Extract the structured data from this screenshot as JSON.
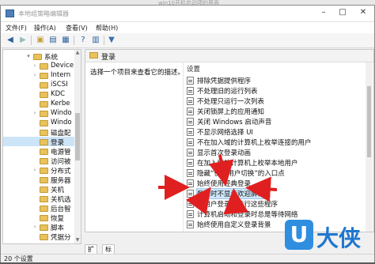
{
  "window": {
    "title": "本地组策略编辑器",
    "top_strip_text": "win10开机启动项的界面"
  },
  "menu": [
    "文件(F)",
    "操作(A)",
    "查看(V)",
    "帮助(H)"
  ],
  "toolbar": {
    "icons": [
      "back-icon",
      "forward-icon",
      "up-folder-icon",
      "show-hide-tree-icon",
      "export-icon",
      "help-icon",
      "properties-icon",
      "filter-icon"
    ]
  },
  "tree": {
    "items": [
      {
        "label": "系统",
        "expanded": true,
        "depth": 0,
        "selected": false
      },
      {
        "label": "Device",
        "expanded": false,
        "depth": 1,
        "selected": false
      },
      {
        "label": "Intern",
        "expanded": false,
        "depth": 1,
        "selected": false
      },
      {
        "label": "iSCSI",
        "expanded": false,
        "depth": 1,
        "selected": false
      },
      {
        "label": "KDC",
        "expanded": false,
        "depth": 1,
        "selected": false
      },
      {
        "label": "Kerbe",
        "expanded": false,
        "depth": 1,
        "selected": false
      },
      {
        "label": "Windo",
        "expanded": false,
        "depth": 1,
        "selected": false
      },
      {
        "label": "Windo",
        "expanded": false,
        "depth": 1,
        "selected": false
      },
      {
        "label": "磁盘配",
        "expanded": false,
        "depth": 1,
        "selected": false
      },
      {
        "label": "登录",
        "expanded": false,
        "depth": 1,
        "selected": true
      },
      {
        "label": "电源管",
        "expanded": false,
        "depth": 1,
        "selected": false
      },
      {
        "label": "访问被",
        "expanded": false,
        "depth": 1,
        "selected": false
      },
      {
        "label": "分布式",
        "expanded": false,
        "depth": 1,
        "selected": false
      },
      {
        "label": "服务器",
        "expanded": false,
        "depth": 1,
        "selected": false
      },
      {
        "label": "关机",
        "expanded": false,
        "depth": 1,
        "selected": false
      },
      {
        "label": "关机选",
        "expanded": false,
        "depth": 1,
        "selected": false
      },
      {
        "label": "后台智",
        "expanded": false,
        "depth": 1,
        "selected": false
      },
      {
        "label": "恢复",
        "expanded": false,
        "depth": 1,
        "selected": false
      },
      {
        "label": "脚本",
        "expanded": false,
        "depth": 1,
        "selected": false
      },
      {
        "label": "凭据分",
        "expanded": false,
        "depth": 1,
        "selected": false
      }
    ]
  },
  "right": {
    "header": "登录",
    "description": "选择一个项目来查看它的描述。",
    "column_header": "设置",
    "settings": [
      "排除凭据提供程序",
      "不处理旧的运行列表",
      "不处理只运行一次列表",
      "关闭锁屏上的应用通知",
      "关闭 Windows 启动声音",
      "不显示网络选择 UI",
      "不在加入域的计算机上枚举连接的用户",
      "显示首次登录动画",
      "在加入域的计算机上枚举本地用户",
      "隐藏“快速用户切换”的入口点",
      "始终使用经典登录",
      "登录时不显示欢迎屏幕",
      "在用户登录时运行这些程序",
      "计算机启动和登录时总是等待网络",
      "始终使用自定义登录背景"
    ],
    "highlighted_index": 11
  },
  "tabs": [
    "扩展",
    "标准"
  ],
  "active_tab": "标准",
  "status": "20 个设置",
  "watermark": {
    "letter": "U",
    "text": "大侠"
  },
  "colors": {
    "annotation_arrow": "#e02020",
    "selection": "#cce4f7",
    "watermark": "#2f8ee0"
  }
}
